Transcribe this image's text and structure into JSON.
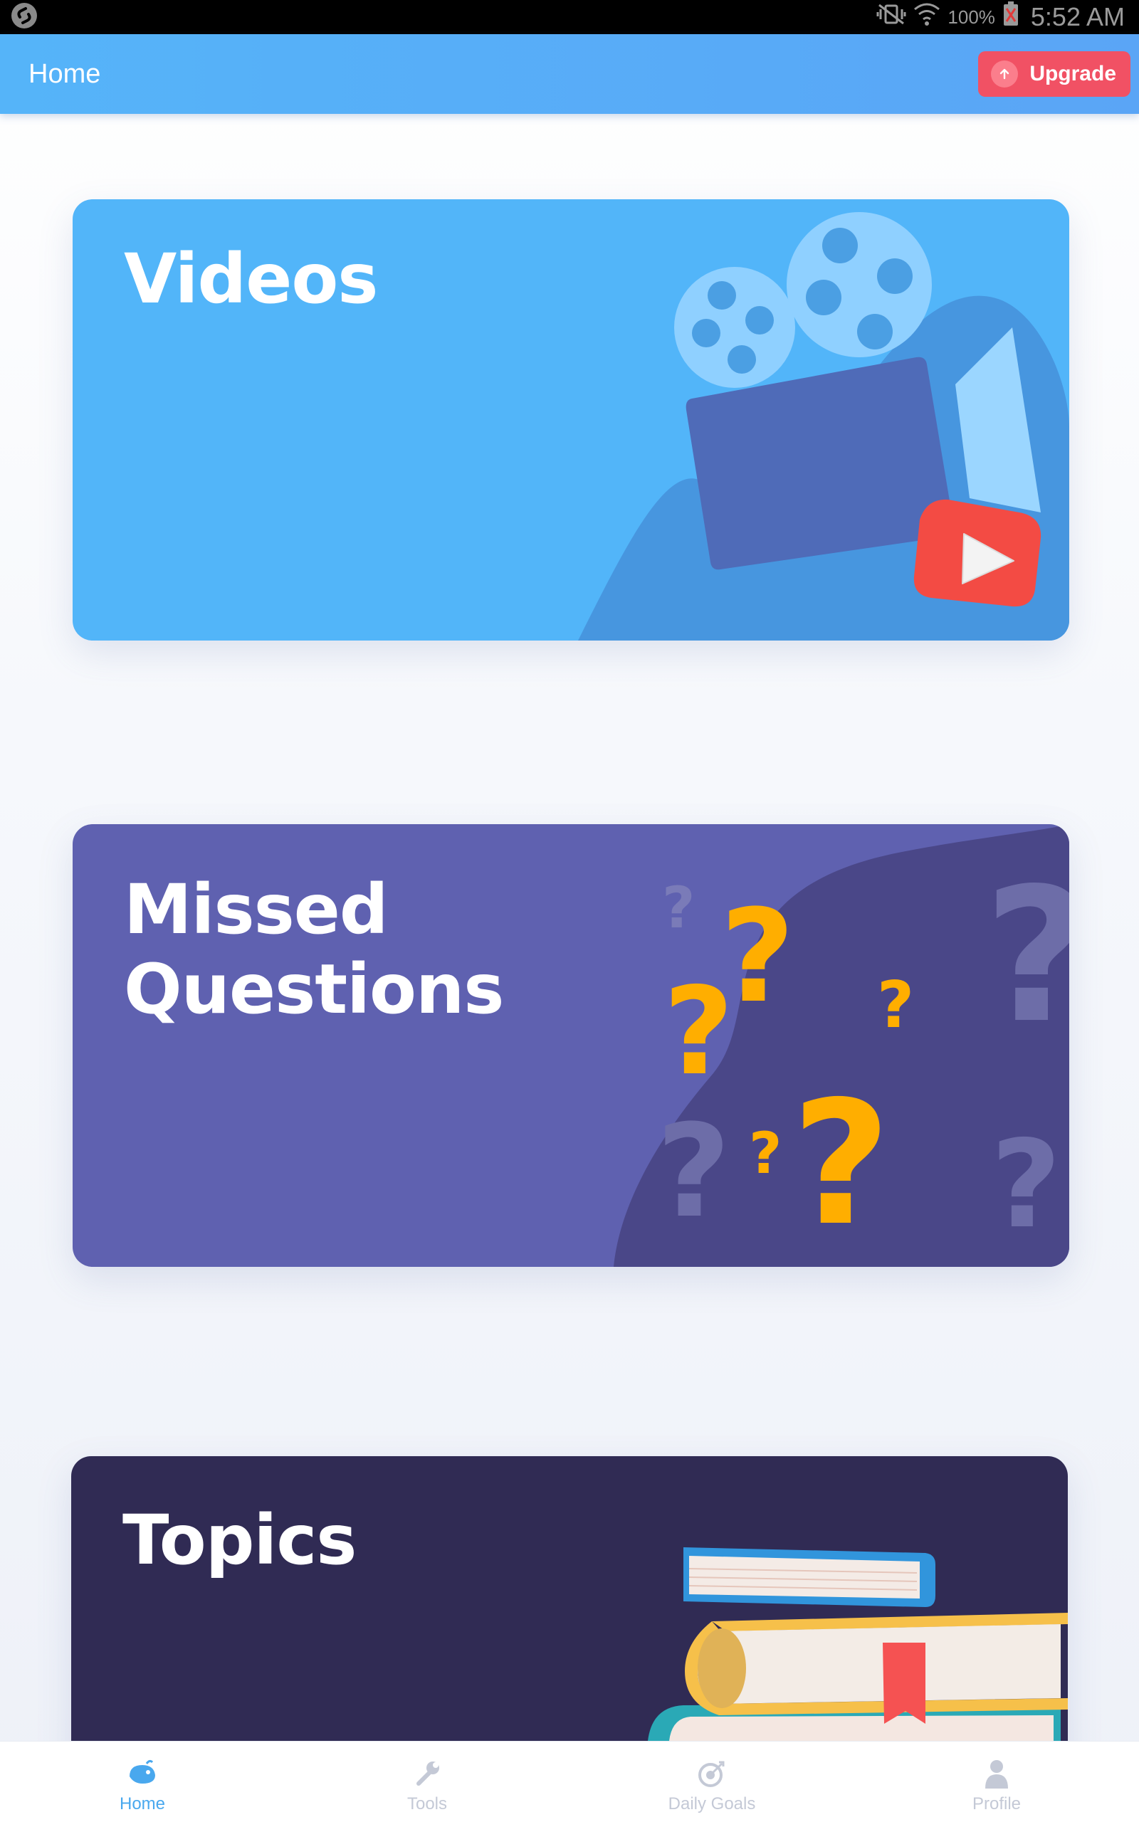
{
  "status_bar": {
    "battery": "100%",
    "time": "5:52 AM"
  },
  "app_bar": {
    "title": "Home",
    "upgrade_label": "Upgrade"
  },
  "cards": [
    {
      "title": "Videos"
    },
    {
      "title": "Missed\nQuestions"
    },
    {
      "title": "Topics"
    }
  ],
  "bottom_nav": [
    {
      "label": "Home",
      "icon": "whale-icon",
      "active": true
    },
    {
      "label": "Tools",
      "icon": "wrench-icon",
      "active": false
    },
    {
      "label": "Daily Goals",
      "icon": "target-icon",
      "active": false
    },
    {
      "label": "Profile",
      "icon": "person-icon",
      "active": false
    }
  ],
  "colors": {
    "app_bar": "#55b4f9",
    "upgrade": "#f15164",
    "videos_card": "#52b5f9",
    "missed_card": "#5f61b0",
    "topics_card": "#302b54",
    "nav_active": "#49a8ee",
    "nav_inactive": "#c4c9d6"
  }
}
